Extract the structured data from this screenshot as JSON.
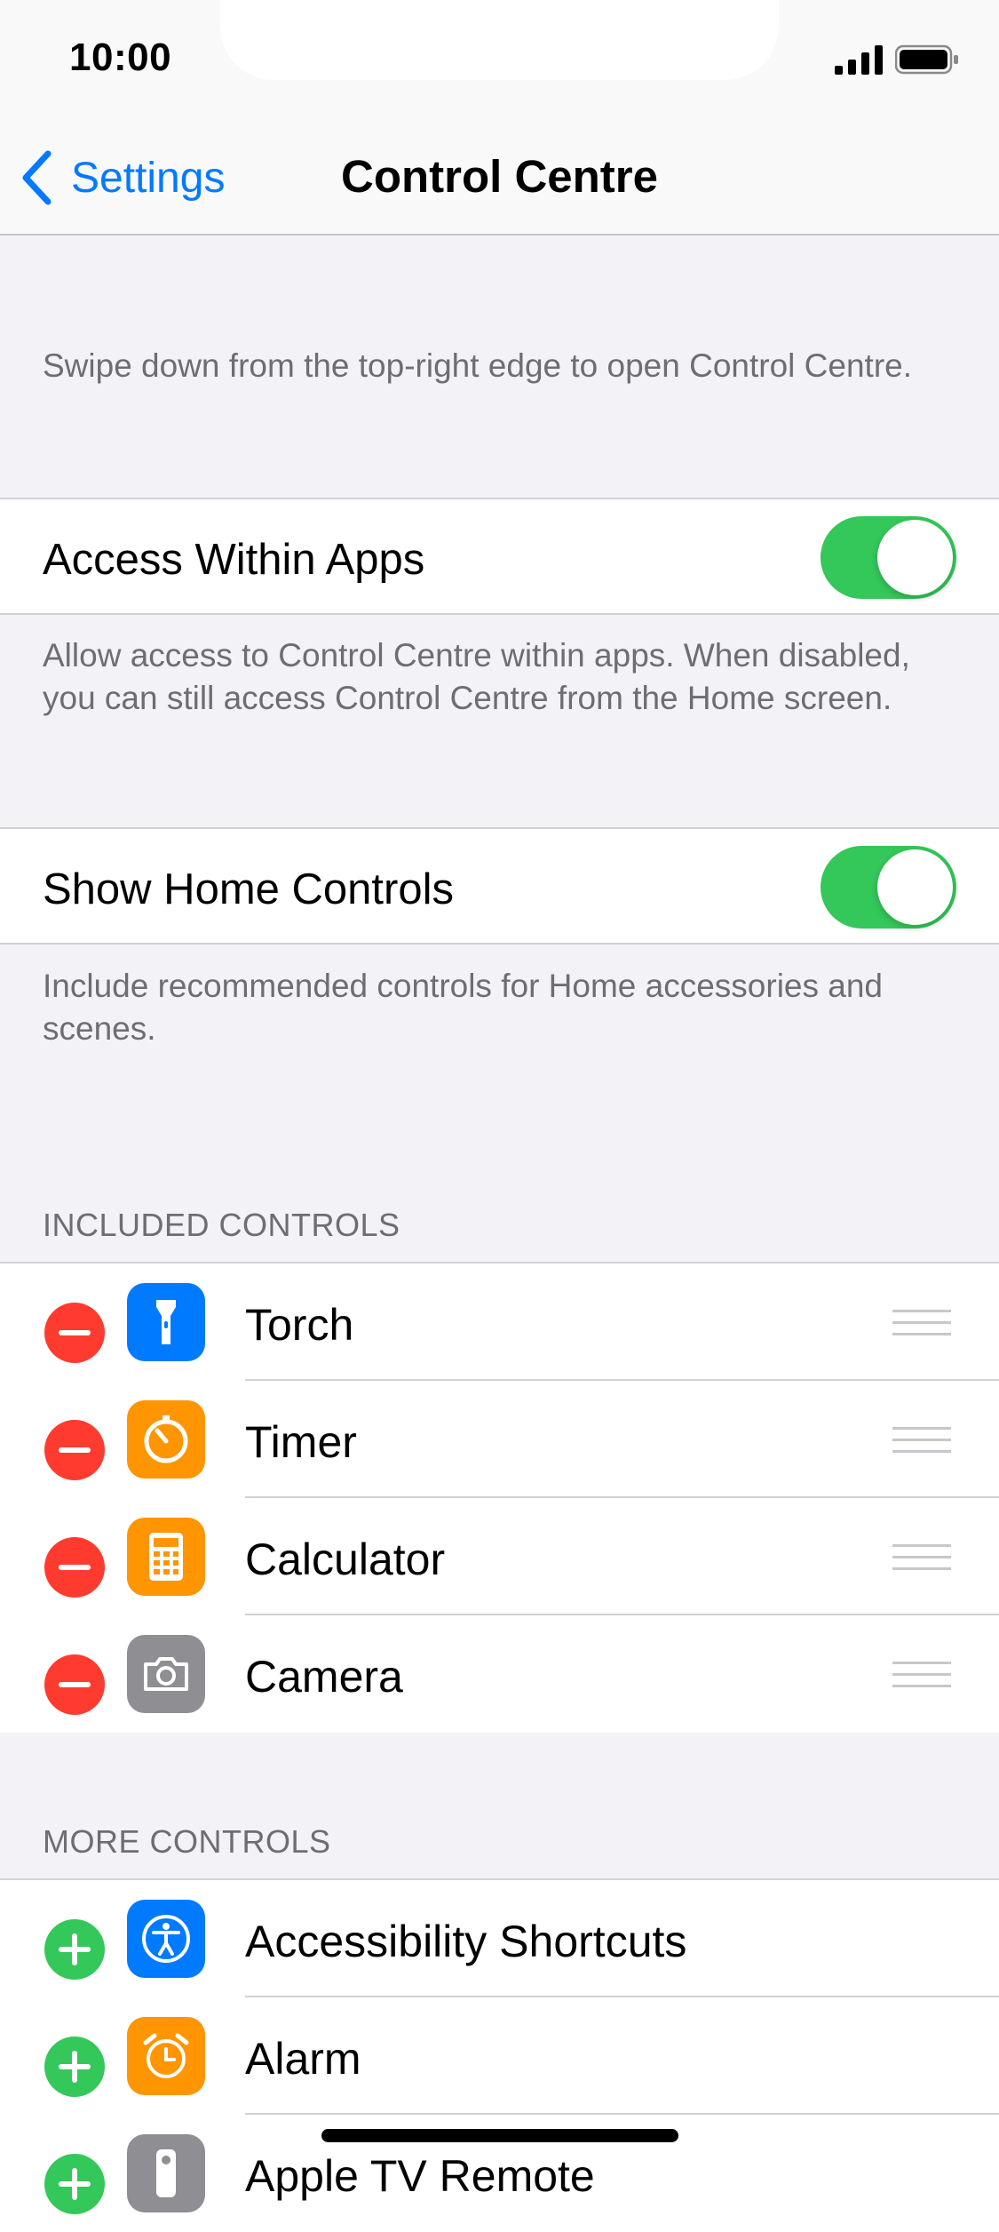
{
  "status_bar": {
    "time": "10:00"
  },
  "nav": {
    "back_label": "Settings",
    "title": "Control Centre"
  },
  "intro_text": "Swipe down from the top-right edge to open Control Centre.",
  "access_within_apps": {
    "label": "Access Within Apps",
    "enabled": true,
    "footer": "Allow access to Control Centre within apps. When disabled, you can still access Control Centre from the Home screen."
  },
  "show_home_controls": {
    "label": "Show Home Controls",
    "enabled": true,
    "footer": "Include recommended controls for Home accessories and scenes."
  },
  "included_controls": {
    "header": "INCLUDED CONTROLS",
    "items": [
      {
        "label": "Torch",
        "icon": "torch-icon",
        "color": "#007aff"
      },
      {
        "label": "Timer",
        "icon": "timer-icon",
        "color": "#ff9500"
      },
      {
        "label": "Calculator",
        "icon": "calculator-icon",
        "color": "#ff9500"
      },
      {
        "label": "Camera",
        "icon": "camera-icon",
        "color": "#8e8e93"
      }
    ]
  },
  "more_controls": {
    "header": "MORE CONTROLS",
    "items": [
      {
        "label": "Accessibility Shortcuts",
        "icon": "accessibility-icon",
        "color": "#007aff"
      },
      {
        "label": "Alarm",
        "icon": "alarm-icon",
        "color": "#ff9500"
      },
      {
        "label": "Apple TV Remote",
        "icon": "remote-icon",
        "color": "#8e8e93"
      }
    ]
  },
  "colors": {
    "accent": "#007aff",
    "toggle_on": "#34c759",
    "remove": "#ff3b30",
    "add": "#34c759"
  }
}
